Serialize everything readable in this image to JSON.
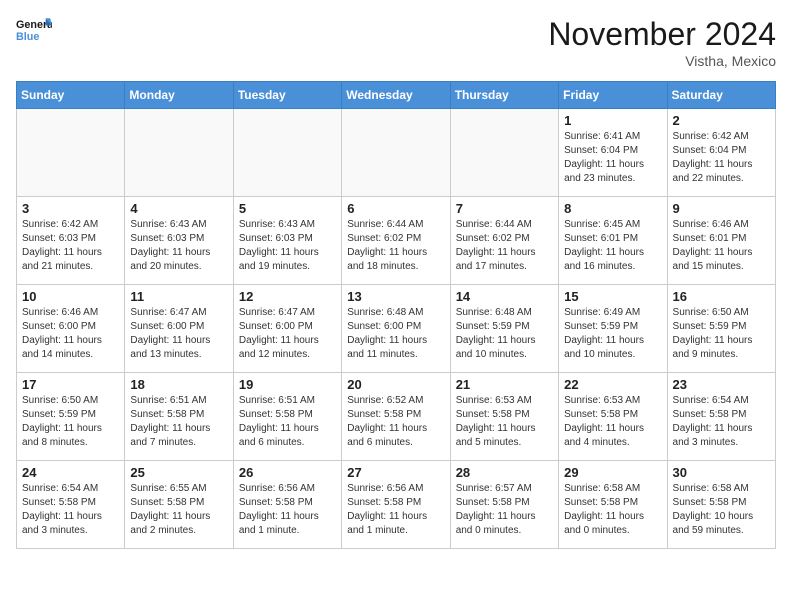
{
  "logo": {
    "line1": "General",
    "line2": "Blue"
  },
  "title": "November 2024",
  "location": "Vistha, Mexico",
  "days_of_week": [
    "Sunday",
    "Monday",
    "Tuesday",
    "Wednesday",
    "Thursday",
    "Friday",
    "Saturday"
  ],
  "weeks": [
    [
      {
        "day": "",
        "info": ""
      },
      {
        "day": "",
        "info": ""
      },
      {
        "day": "",
        "info": ""
      },
      {
        "day": "",
        "info": ""
      },
      {
        "day": "",
        "info": ""
      },
      {
        "day": "1",
        "info": "Sunrise: 6:41 AM\nSunset: 6:04 PM\nDaylight: 11 hours\nand 23 minutes."
      },
      {
        "day": "2",
        "info": "Sunrise: 6:42 AM\nSunset: 6:04 PM\nDaylight: 11 hours\nand 22 minutes."
      }
    ],
    [
      {
        "day": "3",
        "info": "Sunrise: 6:42 AM\nSunset: 6:03 PM\nDaylight: 11 hours\nand 21 minutes."
      },
      {
        "day": "4",
        "info": "Sunrise: 6:43 AM\nSunset: 6:03 PM\nDaylight: 11 hours\nand 20 minutes."
      },
      {
        "day": "5",
        "info": "Sunrise: 6:43 AM\nSunset: 6:03 PM\nDaylight: 11 hours\nand 19 minutes."
      },
      {
        "day": "6",
        "info": "Sunrise: 6:44 AM\nSunset: 6:02 PM\nDaylight: 11 hours\nand 18 minutes."
      },
      {
        "day": "7",
        "info": "Sunrise: 6:44 AM\nSunset: 6:02 PM\nDaylight: 11 hours\nand 17 minutes."
      },
      {
        "day": "8",
        "info": "Sunrise: 6:45 AM\nSunset: 6:01 PM\nDaylight: 11 hours\nand 16 minutes."
      },
      {
        "day": "9",
        "info": "Sunrise: 6:46 AM\nSunset: 6:01 PM\nDaylight: 11 hours\nand 15 minutes."
      }
    ],
    [
      {
        "day": "10",
        "info": "Sunrise: 6:46 AM\nSunset: 6:00 PM\nDaylight: 11 hours\nand 14 minutes."
      },
      {
        "day": "11",
        "info": "Sunrise: 6:47 AM\nSunset: 6:00 PM\nDaylight: 11 hours\nand 13 minutes."
      },
      {
        "day": "12",
        "info": "Sunrise: 6:47 AM\nSunset: 6:00 PM\nDaylight: 11 hours\nand 12 minutes."
      },
      {
        "day": "13",
        "info": "Sunrise: 6:48 AM\nSunset: 6:00 PM\nDaylight: 11 hours\nand 11 minutes."
      },
      {
        "day": "14",
        "info": "Sunrise: 6:48 AM\nSunset: 5:59 PM\nDaylight: 11 hours\nand 10 minutes."
      },
      {
        "day": "15",
        "info": "Sunrise: 6:49 AM\nSunset: 5:59 PM\nDaylight: 11 hours\nand 10 minutes."
      },
      {
        "day": "16",
        "info": "Sunrise: 6:50 AM\nSunset: 5:59 PM\nDaylight: 11 hours\nand 9 minutes."
      }
    ],
    [
      {
        "day": "17",
        "info": "Sunrise: 6:50 AM\nSunset: 5:59 PM\nDaylight: 11 hours\nand 8 minutes."
      },
      {
        "day": "18",
        "info": "Sunrise: 6:51 AM\nSunset: 5:58 PM\nDaylight: 11 hours\nand 7 minutes."
      },
      {
        "day": "19",
        "info": "Sunrise: 6:51 AM\nSunset: 5:58 PM\nDaylight: 11 hours\nand 6 minutes."
      },
      {
        "day": "20",
        "info": "Sunrise: 6:52 AM\nSunset: 5:58 PM\nDaylight: 11 hours\nand 6 minutes."
      },
      {
        "day": "21",
        "info": "Sunrise: 6:53 AM\nSunset: 5:58 PM\nDaylight: 11 hours\nand 5 minutes."
      },
      {
        "day": "22",
        "info": "Sunrise: 6:53 AM\nSunset: 5:58 PM\nDaylight: 11 hours\nand 4 minutes."
      },
      {
        "day": "23",
        "info": "Sunrise: 6:54 AM\nSunset: 5:58 PM\nDaylight: 11 hours\nand 3 minutes."
      }
    ],
    [
      {
        "day": "24",
        "info": "Sunrise: 6:54 AM\nSunset: 5:58 PM\nDaylight: 11 hours\nand 3 minutes."
      },
      {
        "day": "25",
        "info": "Sunrise: 6:55 AM\nSunset: 5:58 PM\nDaylight: 11 hours\nand 2 minutes."
      },
      {
        "day": "26",
        "info": "Sunrise: 6:56 AM\nSunset: 5:58 PM\nDaylight: 11 hours\nand 1 minute."
      },
      {
        "day": "27",
        "info": "Sunrise: 6:56 AM\nSunset: 5:58 PM\nDaylight: 11 hours\nand 1 minute."
      },
      {
        "day": "28",
        "info": "Sunrise: 6:57 AM\nSunset: 5:58 PM\nDaylight: 11 hours\nand 0 minutes."
      },
      {
        "day": "29",
        "info": "Sunrise: 6:58 AM\nSunset: 5:58 PM\nDaylight: 11 hours\nand 0 minutes."
      },
      {
        "day": "30",
        "info": "Sunrise: 6:58 AM\nSunset: 5:58 PM\nDaylight: 10 hours\nand 59 minutes."
      }
    ]
  ]
}
